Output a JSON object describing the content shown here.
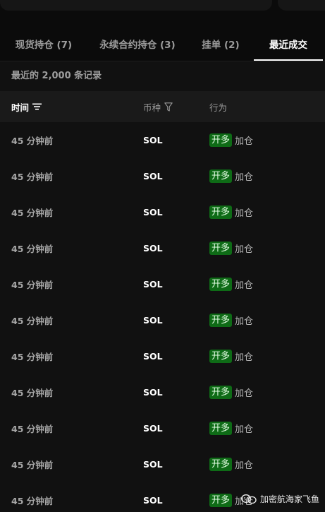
{
  "tabs": [
    {
      "label": "现货持仓 (7)"
    },
    {
      "label": "永续合约持仓 (3)"
    },
    {
      "label": "挂单 (2)"
    },
    {
      "label": "最近成交"
    }
  ],
  "active_tab": "最近成交",
  "records_count": "最近的 2,000 条记录",
  "table": {
    "headers": {
      "time": "时间",
      "coin": "币种",
      "action": "行为"
    },
    "rows": [
      {
        "time": "45 分钟前",
        "coin": "SOL",
        "badge": "开多",
        "action": "加仓"
      },
      {
        "time": "45 分钟前",
        "coin": "SOL",
        "badge": "开多",
        "action": "加仓"
      },
      {
        "time": "45 分钟前",
        "coin": "SOL",
        "badge": "开多",
        "action": "加仓"
      },
      {
        "time": "45 分钟前",
        "coin": "SOL",
        "badge": "开多",
        "action": "加仓"
      },
      {
        "time": "45 分钟前",
        "coin": "SOL",
        "badge": "开多",
        "action": "加仓"
      },
      {
        "time": "45 分钟前",
        "coin": "SOL",
        "badge": "开多",
        "action": "加仓"
      },
      {
        "time": "45 分钟前",
        "coin": "SOL",
        "badge": "开多",
        "action": "加仓"
      },
      {
        "time": "45 分钟前",
        "coin": "SOL",
        "badge": "开多",
        "action": "加仓"
      },
      {
        "time": "45 分钟前",
        "coin": "SOL",
        "badge": "开多",
        "action": "加仓"
      },
      {
        "time": "45 分钟前",
        "coin": "SOL",
        "badge": "开多",
        "action": "加仓"
      },
      {
        "time": "45 分钟前",
        "coin": "SOL",
        "badge": "开多",
        "action": "加仓"
      }
    ]
  },
  "icons": {
    "sort": "sort-icon",
    "filter": "filter-icon",
    "watermark_logo": "wechat-logo-icon"
  },
  "colors": {
    "badge_long": "#0e6b16",
    "active_tab": "#ffffff",
    "background": "#111111"
  },
  "watermark": "加密航海家飞鱼"
}
